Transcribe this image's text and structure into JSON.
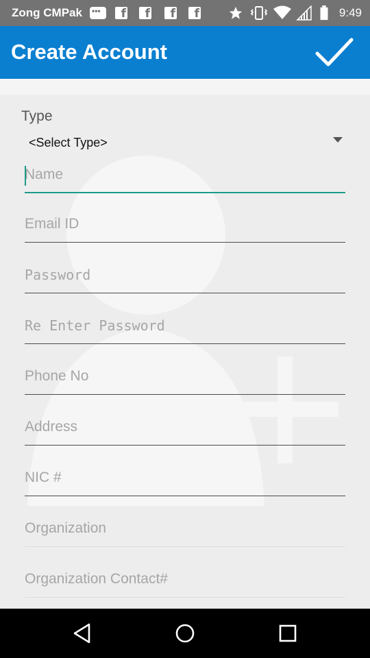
{
  "status_bar": {
    "carrier": "Zong CMPak",
    "time": "9:49",
    "icons": [
      "message-icon",
      "facebook-icon",
      "facebook-icon",
      "facebook-icon",
      "facebook-icon",
      "star-icon",
      "vibrate-icon",
      "wifi-icon",
      "signal-icon",
      "battery-icon"
    ]
  },
  "app_bar": {
    "title": "Create Account",
    "action_icon": "check-icon"
  },
  "form": {
    "type_label": "Type",
    "type_select": {
      "value": "<Select Type>"
    },
    "fields": {
      "name": "Name",
      "email": "Email ID",
      "password": "Password",
      "reenter_password": "Re Enter Password",
      "phone": "Phone No",
      "address": "Address",
      "nic": "NIC #",
      "organization": "Organization",
      "organization_contact": "Organization Contact#"
    }
  },
  "nav_bar": {
    "buttons": [
      "back-icon",
      "home-icon",
      "recents-icon"
    ]
  },
  "colors": {
    "app_bar": "#0a7fd0",
    "status_bar": "#737373",
    "accent": "#1c9a86",
    "background": "#ededed"
  }
}
